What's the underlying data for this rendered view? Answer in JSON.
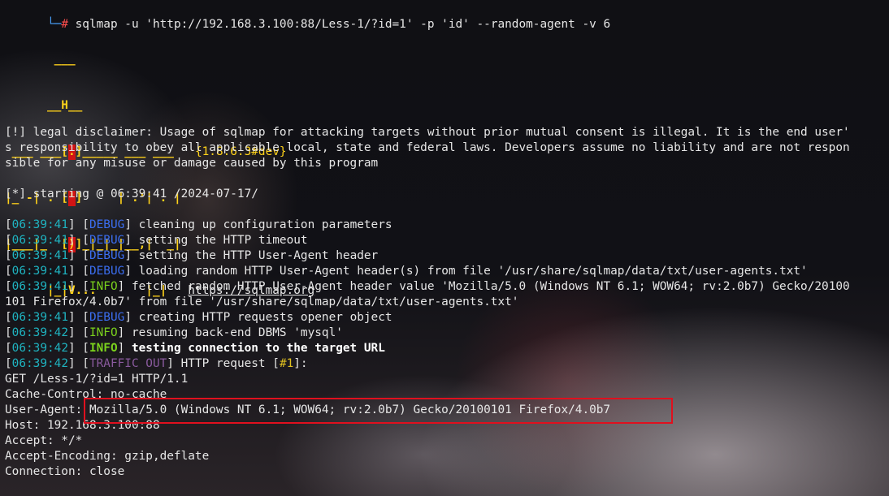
{
  "terminal": {
    "command": {
      "prompt": "└─",
      "hash": "#",
      "text": " sqlmap -u 'http://192.168.3.100:88/Less-1/?id=1' -p 'id' --random-agent -v 6"
    },
    "banner": {
      "l1": "       ___",
      "l2": "      __H__",
      "l3a": " ___ ___[",
      "l3b": ".",
      "l3c": "]_____ ___ ___  ",
      "l4a": "|_ -| . [",
      "l4b": "'",
      "l4c": "]     | .'| . |",
      "l5a": "|___|_  [",
      "l5b": ")",
      "l5c": "]_|_|_|__,|  _|",
      "l6": "      |_|V...       |_|   ",
      "version": "{1.8.6.3#dev}",
      "url": "https://sqlmap.org"
    },
    "disclaimer": [
      "[!] legal disclaimer: Usage of sqlmap for attacking targets without prior mutual consent is illegal. It is the end user'",
      "s responsibility to obey all applicable local, state and federal laws. Developers assume no liability and are not respon",
      "sible for any misuse or damage caused by this program"
    ],
    "starting": "[*] starting @ 06:39:41 /2024-07-17/",
    "logs": [
      {
        "time": "06:39:41",
        "level": "DEBUG",
        "msg": " cleaning up configuration parameters"
      },
      {
        "time": "06:39:41",
        "level": "DEBUG",
        "msg": " setting the HTTP timeout"
      },
      {
        "time": "06:39:41",
        "level": "DEBUG",
        "msg": " setting the HTTP User-Agent header"
      },
      {
        "time": "06:39:41",
        "level": "DEBUG",
        "msg": " loading random HTTP User-Agent header(s) from file '/usr/share/sqlmap/data/txt/user-agents.txt'"
      },
      {
        "time": "06:39:41",
        "level": "INFO",
        "msg": " fetched random HTTP User-Agent header value 'Mozilla/5.0 (Windows NT 6.1; WOW64; rv:2.0b7) Gecko/20100"
      },
      {
        "time": "06:39:41",
        "level": "DEBUG",
        "msg": " creating HTTP requests opener object"
      },
      {
        "time": "06:39:42",
        "level": "INFO",
        "msg": " resuming back-end DBMS 'mysql'"
      },
      {
        "time": "06:39:42",
        "level": "INFO",
        "msg": " testing connection to the target URL"
      },
      {
        "time": "06:39:42",
        "level": "TRAFFIC OUT",
        "msg": " HTTP request [",
        "num": "#1",
        "tail": "]:"
      }
    ],
    "wrap_line": "101 Firefox/4.0b7' from file '/usr/share/sqlmap/data/txt/user-agents.txt'",
    "request": [
      "GET /Less-1/?id=1 HTTP/1.1",
      "Cache-Control: no-cache",
      "User-Agent: Mozilla/5.0 (Windows NT 6.1; WOW64; rv:2.0b7) Gecko/20100101 Firefox/4.0b7",
      "Host: 192.168.3.100:88",
      "Accept: */*",
      "Accept-Encoding: gzip,deflate",
      "Connection: close"
    ],
    "colors": {
      "highlight_box": "#e0101e",
      "debug": "#3b6ef0",
      "info": "#7bd21d",
      "time": "#1fb3c0",
      "banner": "#ffd21a"
    }
  }
}
